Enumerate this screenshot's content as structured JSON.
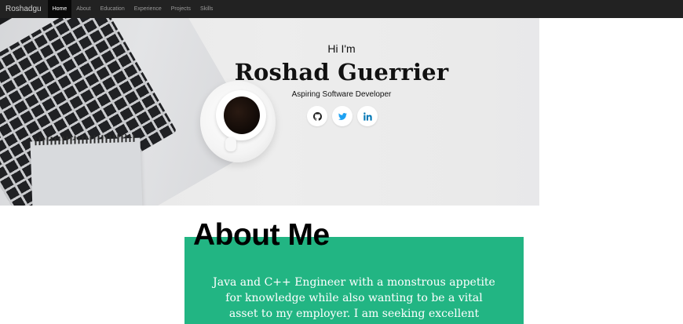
{
  "navbar": {
    "brand": "Roshadgu",
    "items": [
      {
        "label": "Home",
        "active": true
      },
      {
        "label": "About",
        "active": false
      },
      {
        "label": "Education",
        "active": false
      },
      {
        "label": "Experience",
        "active": false
      },
      {
        "label": "Projects",
        "active": false
      },
      {
        "label": "Skills",
        "active": false
      }
    ]
  },
  "hero": {
    "greeting": "Hi I'm",
    "name": "Roshad Guerrier",
    "subtitle": "Aspiring Software Developer",
    "socials": [
      {
        "icon": "github-icon",
        "color": "#222222"
      },
      {
        "icon": "twitter-icon",
        "color": "#1da1f2"
      },
      {
        "icon": "linkedin-icon",
        "color": "#0077b5"
      }
    ]
  },
  "about": {
    "title": "About Me",
    "text": "Java and C++ Engineer with a monstrous appetite for knowledge while also wanting to be a vital asset to my employer. I am seeking excellent",
    "accent_color": "#22b583"
  }
}
